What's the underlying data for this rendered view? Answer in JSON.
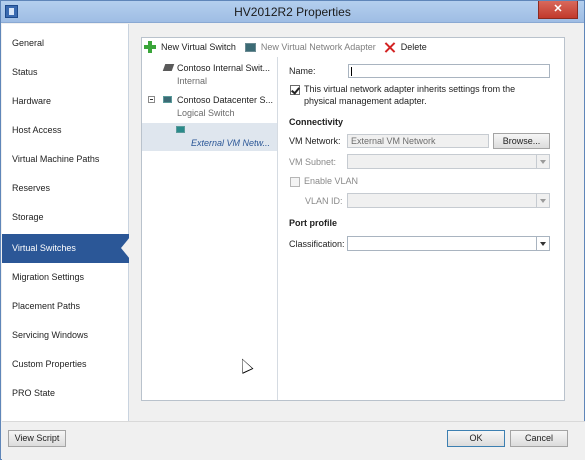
{
  "window": {
    "title": "HV2012R2 Properties",
    "close_glyph": "✕"
  },
  "nav": {
    "items": [
      {
        "label": "General"
      },
      {
        "label": "Status"
      },
      {
        "label": "Hardware"
      },
      {
        "label": "Host Access"
      },
      {
        "label": "Virtual Machine Paths"
      },
      {
        "label": "Reserves"
      },
      {
        "label": "Storage"
      },
      {
        "label": "Virtual Switches",
        "selected": true
      },
      {
        "label": "Migration Settings"
      },
      {
        "label": "Placement Paths"
      },
      {
        "label": "Servicing Windows"
      },
      {
        "label": "Custom Properties"
      },
      {
        "label": "PRO State"
      }
    ]
  },
  "toolbar": {
    "new_switch": "New Virtual Switch",
    "new_adapter": "New Virtual Network Adapter",
    "delete": "Delete"
  },
  "tree": {
    "node1": {
      "name": "Contoso Internal Swit...",
      "type": "Internal"
    },
    "node2": {
      "name": "Contoso Datacenter S...",
      "type": "Logical Switch"
    },
    "child": {
      "name": "External VM Netw..."
    }
  },
  "props": {
    "name_label": "Name:",
    "name_value": "",
    "inherit_text_1": "This virtual network adapter inherits settings from the",
    "inherit_text_2": "physical management adapter.",
    "inherit_checked": true,
    "connectivity_heading": "Connectivity",
    "vm_network_label": "VM Network:",
    "vm_network_value": "External VM Network",
    "browse_label": "Browse...",
    "vm_subnet_label": "VM Subnet:",
    "enable_vlan_label": "Enable VLAN",
    "vlan_id_label": "VLAN ID:",
    "port_profile_heading": "Port profile",
    "classification_label": "Classification:"
  },
  "footer": {
    "view_script": "View Script",
    "ok": "OK",
    "cancel": "Cancel"
  }
}
